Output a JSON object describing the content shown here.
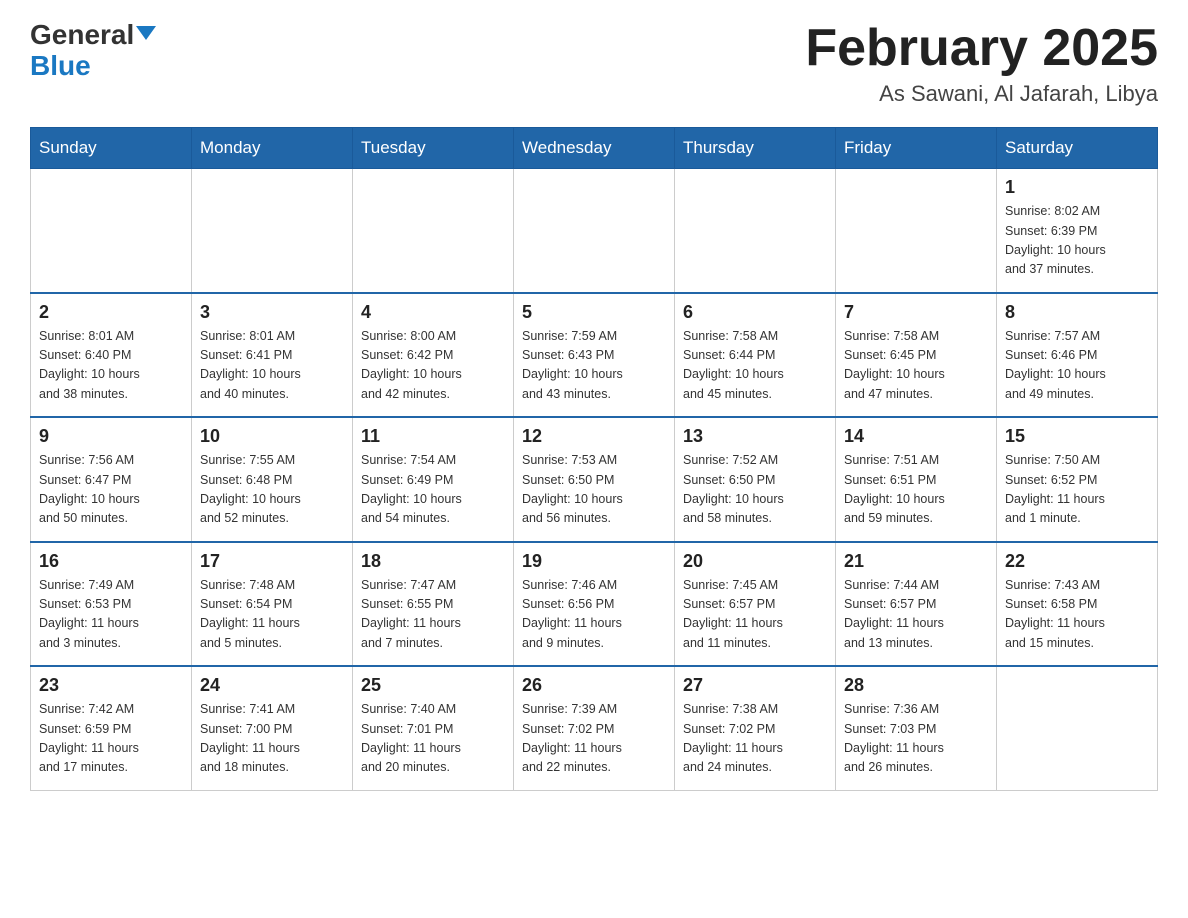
{
  "header": {
    "logo_general": "General",
    "logo_blue": "Blue",
    "month_title": "February 2025",
    "location": "As Sawani, Al Jafarah, Libya"
  },
  "days_of_week": [
    "Sunday",
    "Monday",
    "Tuesday",
    "Wednesday",
    "Thursday",
    "Friday",
    "Saturday"
  ],
  "weeks": [
    {
      "days": [
        {
          "num": "",
          "info": ""
        },
        {
          "num": "",
          "info": ""
        },
        {
          "num": "",
          "info": ""
        },
        {
          "num": "",
          "info": ""
        },
        {
          "num": "",
          "info": ""
        },
        {
          "num": "",
          "info": ""
        },
        {
          "num": "1",
          "info": "Sunrise: 8:02 AM\nSunset: 6:39 PM\nDaylight: 10 hours\nand 37 minutes."
        }
      ]
    },
    {
      "days": [
        {
          "num": "2",
          "info": "Sunrise: 8:01 AM\nSunset: 6:40 PM\nDaylight: 10 hours\nand 38 minutes."
        },
        {
          "num": "3",
          "info": "Sunrise: 8:01 AM\nSunset: 6:41 PM\nDaylight: 10 hours\nand 40 minutes."
        },
        {
          "num": "4",
          "info": "Sunrise: 8:00 AM\nSunset: 6:42 PM\nDaylight: 10 hours\nand 42 minutes."
        },
        {
          "num": "5",
          "info": "Sunrise: 7:59 AM\nSunset: 6:43 PM\nDaylight: 10 hours\nand 43 minutes."
        },
        {
          "num": "6",
          "info": "Sunrise: 7:58 AM\nSunset: 6:44 PM\nDaylight: 10 hours\nand 45 minutes."
        },
        {
          "num": "7",
          "info": "Sunrise: 7:58 AM\nSunset: 6:45 PM\nDaylight: 10 hours\nand 47 minutes."
        },
        {
          "num": "8",
          "info": "Sunrise: 7:57 AM\nSunset: 6:46 PM\nDaylight: 10 hours\nand 49 minutes."
        }
      ]
    },
    {
      "days": [
        {
          "num": "9",
          "info": "Sunrise: 7:56 AM\nSunset: 6:47 PM\nDaylight: 10 hours\nand 50 minutes."
        },
        {
          "num": "10",
          "info": "Sunrise: 7:55 AM\nSunset: 6:48 PM\nDaylight: 10 hours\nand 52 minutes."
        },
        {
          "num": "11",
          "info": "Sunrise: 7:54 AM\nSunset: 6:49 PM\nDaylight: 10 hours\nand 54 minutes."
        },
        {
          "num": "12",
          "info": "Sunrise: 7:53 AM\nSunset: 6:50 PM\nDaylight: 10 hours\nand 56 minutes."
        },
        {
          "num": "13",
          "info": "Sunrise: 7:52 AM\nSunset: 6:50 PM\nDaylight: 10 hours\nand 58 minutes."
        },
        {
          "num": "14",
          "info": "Sunrise: 7:51 AM\nSunset: 6:51 PM\nDaylight: 10 hours\nand 59 minutes."
        },
        {
          "num": "15",
          "info": "Sunrise: 7:50 AM\nSunset: 6:52 PM\nDaylight: 11 hours\nand 1 minute."
        }
      ]
    },
    {
      "days": [
        {
          "num": "16",
          "info": "Sunrise: 7:49 AM\nSunset: 6:53 PM\nDaylight: 11 hours\nand 3 minutes."
        },
        {
          "num": "17",
          "info": "Sunrise: 7:48 AM\nSunset: 6:54 PM\nDaylight: 11 hours\nand 5 minutes."
        },
        {
          "num": "18",
          "info": "Sunrise: 7:47 AM\nSunset: 6:55 PM\nDaylight: 11 hours\nand 7 minutes."
        },
        {
          "num": "19",
          "info": "Sunrise: 7:46 AM\nSunset: 6:56 PM\nDaylight: 11 hours\nand 9 minutes."
        },
        {
          "num": "20",
          "info": "Sunrise: 7:45 AM\nSunset: 6:57 PM\nDaylight: 11 hours\nand 11 minutes."
        },
        {
          "num": "21",
          "info": "Sunrise: 7:44 AM\nSunset: 6:57 PM\nDaylight: 11 hours\nand 13 minutes."
        },
        {
          "num": "22",
          "info": "Sunrise: 7:43 AM\nSunset: 6:58 PM\nDaylight: 11 hours\nand 15 minutes."
        }
      ]
    },
    {
      "days": [
        {
          "num": "23",
          "info": "Sunrise: 7:42 AM\nSunset: 6:59 PM\nDaylight: 11 hours\nand 17 minutes."
        },
        {
          "num": "24",
          "info": "Sunrise: 7:41 AM\nSunset: 7:00 PM\nDaylight: 11 hours\nand 18 minutes."
        },
        {
          "num": "25",
          "info": "Sunrise: 7:40 AM\nSunset: 7:01 PM\nDaylight: 11 hours\nand 20 minutes."
        },
        {
          "num": "26",
          "info": "Sunrise: 7:39 AM\nSunset: 7:02 PM\nDaylight: 11 hours\nand 22 minutes."
        },
        {
          "num": "27",
          "info": "Sunrise: 7:38 AM\nSunset: 7:02 PM\nDaylight: 11 hours\nand 24 minutes."
        },
        {
          "num": "28",
          "info": "Sunrise: 7:36 AM\nSunset: 7:03 PM\nDaylight: 11 hours\nand 26 minutes."
        },
        {
          "num": "",
          "info": ""
        }
      ]
    }
  ]
}
